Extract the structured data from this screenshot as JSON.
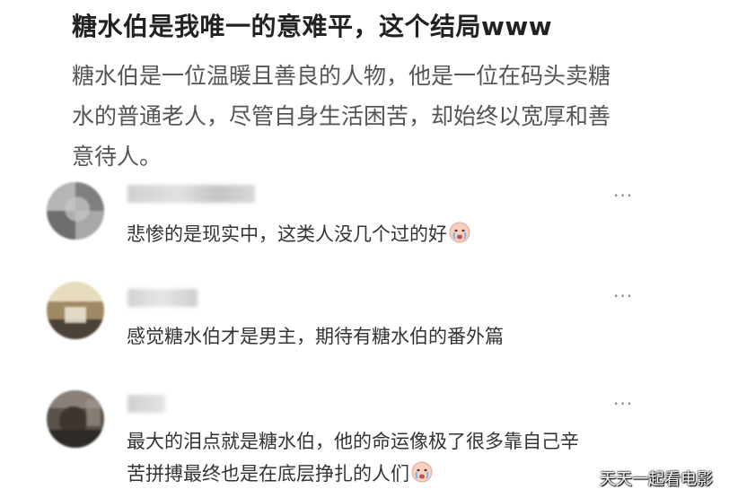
{
  "post": {
    "title": "糖水伯是我唯一的意难平，这个结局www",
    "body_lines": [
      "糖水伯是一位温暖且善良的人物，他是一位在码头卖糖",
      "水的普通老人，尽管自身生活困苦，却始终以宽厚和善",
      "意待人。"
    ]
  },
  "comments": [
    {
      "more_label": "···",
      "text_lines": [
        "悲惨的是现实中，这类人没几个过的好"
      ],
      "emoji": "crying-face-icon"
    },
    {
      "more_label": "···",
      "text_lines": [
        "感觉糖水伯才是男主，期待有糖水伯的番外篇"
      ]
    },
    {
      "more_label": "···",
      "text_lines": [
        "最大的泪点就是糖水伯，他的命运像极了很多靠自己辛",
        "苦拼搏最终也是在底层挣扎的人们"
      ],
      "emoji": "crying-face-icon"
    }
  ],
  "watermark": "天天一起看电影",
  "colors": {
    "title": "#222222",
    "body": "#555555",
    "comment_text": "#333333",
    "more_icon": "#888888"
  }
}
